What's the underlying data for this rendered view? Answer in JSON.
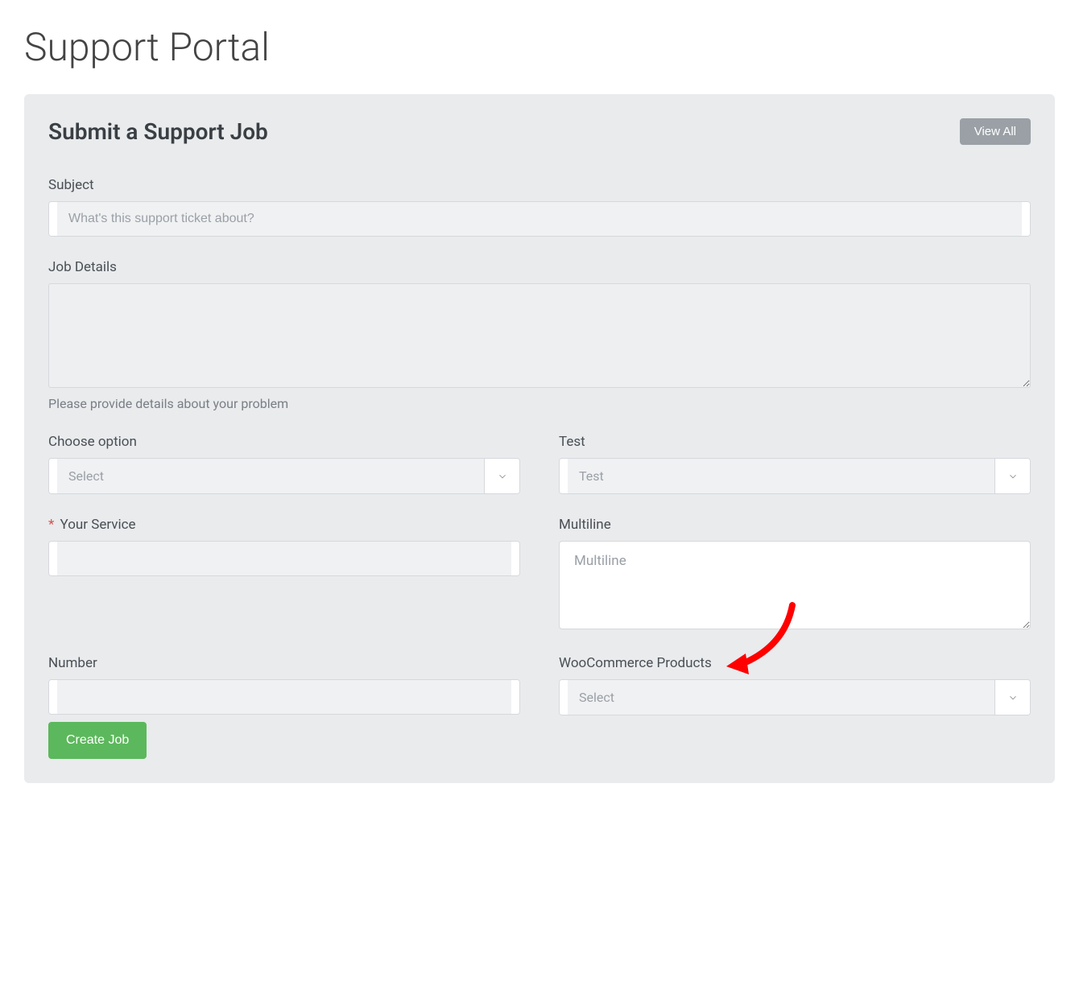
{
  "page": {
    "title": "Support Portal"
  },
  "panel": {
    "title": "Submit a Support Job",
    "view_all_label": "View All"
  },
  "form": {
    "subject": {
      "label": "Subject",
      "placeholder": "What's this support ticket about?",
      "value": ""
    },
    "job_details": {
      "label": "Job Details",
      "value": "",
      "helper": "Please provide details about your problem"
    },
    "choose_option": {
      "label": "Choose option",
      "selected": "Select"
    },
    "test": {
      "label": "Test",
      "selected": "Test"
    },
    "your_service": {
      "label": "Your Service",
      "value": "",
      "required": true
    },
    "multiline": {
      "label": "Multiline",
      "placeholder": "Multiline",
      "value": ""
    },
    "number": {
      "label": "Number",
      "value": ""
    },
    "woocommerce_products": {
      "label": "WooCommerce Products",
      "selected": "Select"
    },
    "submit_label": "Create Job"
  }
}
